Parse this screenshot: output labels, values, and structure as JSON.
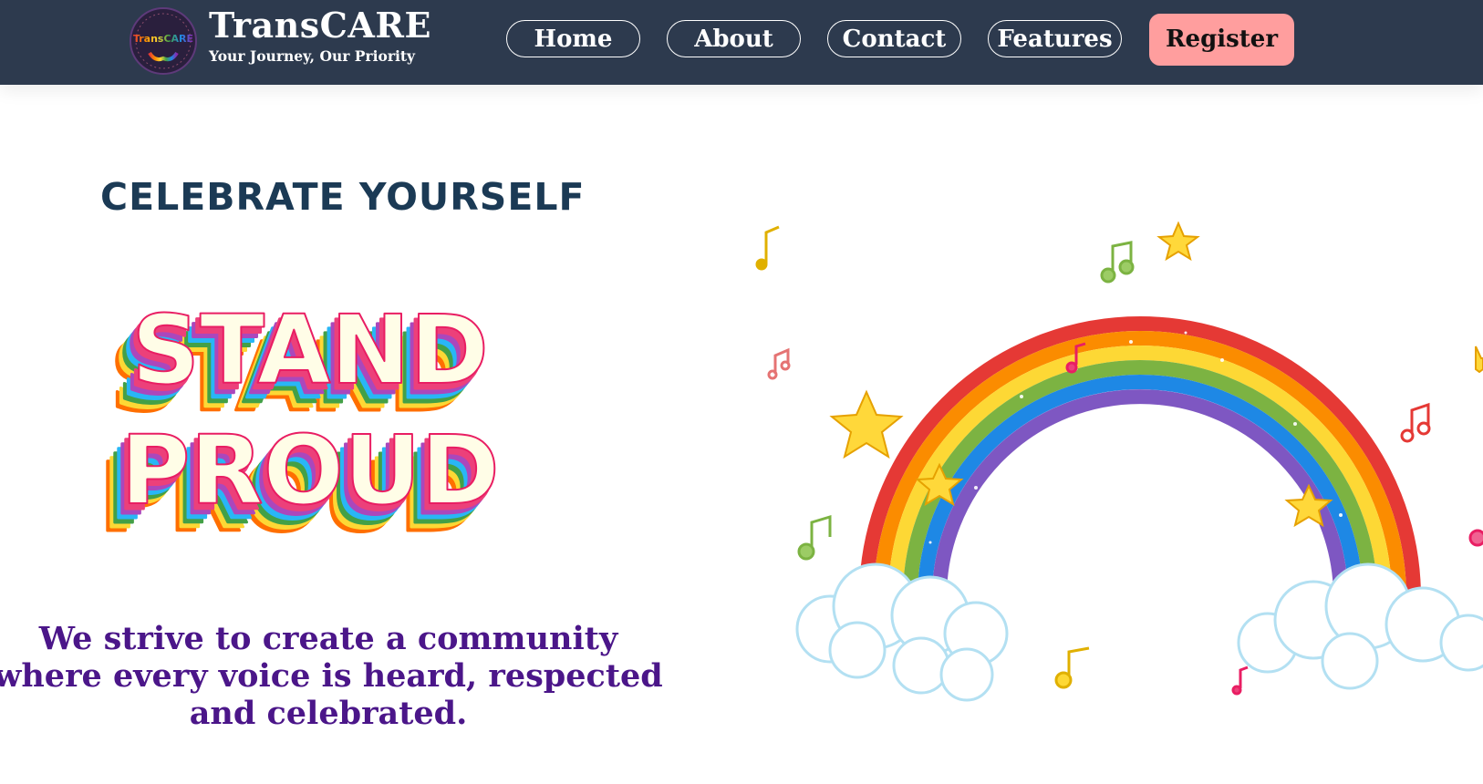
{
  "header": {
    "logo_text": "TransCARE",
    "brand_title": "TransCARE",
    "brand_tagline": "Your Journey, Our Priority",
    "nav": [
      {
        "label": "Home"
      },
      {
        "label": "About"
      },
      {
        "label": "Contact"
      },
      {
        "label": "Features"
      }
    ],
    "register_label": "Register"
  },
  "hero": {
    "eyebrow": "CELEBRATE YOURSELF",
    "headline_line1": "STAND",
    "headline_line2": "PROUD",
    "mission": "We strive to create a community where every voice is heard, respected and celebrated."
  },
  "colors": {
    "header_bg": "#2d3a4e",
    "register_bg": "#ff9e9e",
    "eyebrow": "#1b3a55",
    "mission": "#4b1689",
    "rainbow": [
      "#e53935",
      "#fb8c00",
      "#fdd835",
      "#7cb342",
      "#1e88e5",
      "#7e57c2"
    ]
  },
  "illustration": {
    "name": "rainbow-with-clouds-stars-music-notes"
  }
}
